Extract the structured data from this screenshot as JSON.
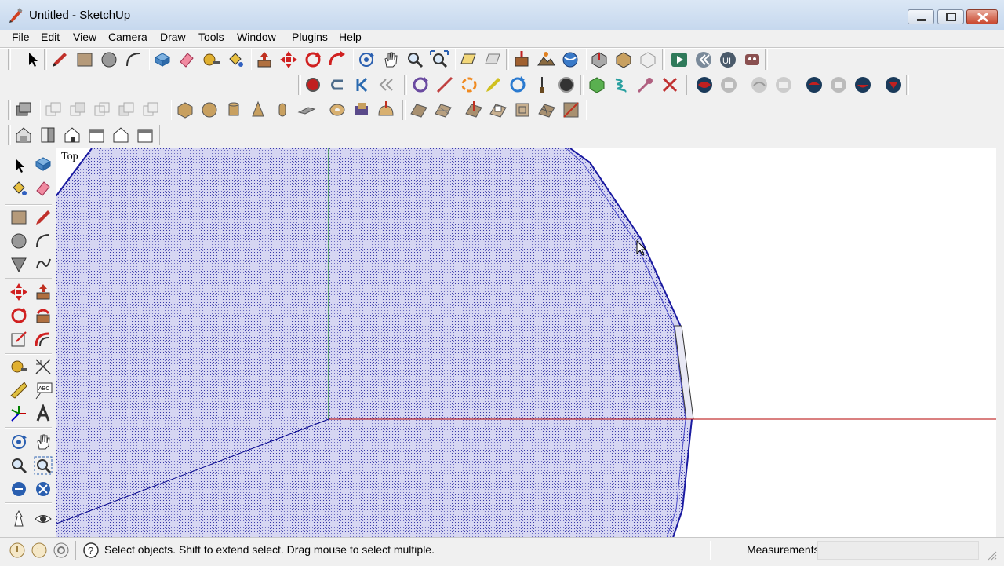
{
  "window": {
    "title": "Untitled - SketchUp",
    "controls": [
      "minimize",
      "maximize",
      "close"
    ]
  },
  "menu": [
    "File",
    "Edit",
    "View",
    "Camera",
    "Draw",
    "Tools",
    "Window",
    "Plugins",
    "Help"
  ],
  "viewport": {
    "view_label": "Top",
    "colors": {
      "face": "#c9c9f0",
      "edge": "#1a1aa0",
      "red_axis": "#b40000",
      "green_axis": "#008a00",
      "blue_axis": "#00008b"
    }
  },
  "status": {
    "hint": "Select objects. Shift to extend select. Drag mouse to select multiple.",
    "measurements_label": "Measurements",
    "measurements_value": ""
  }
}
